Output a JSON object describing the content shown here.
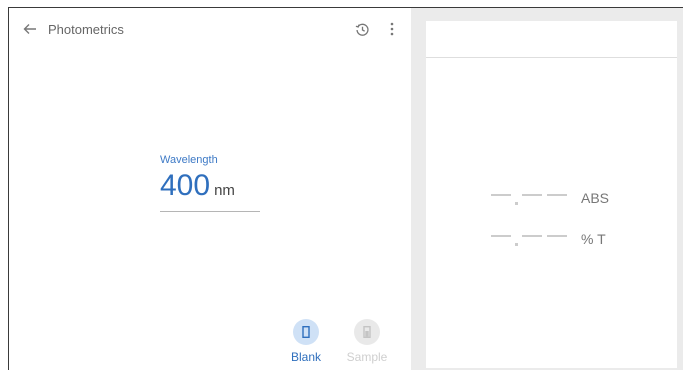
{
  "header": {
    "title": "Photometrics",
    "back_icon": "arrow-left-icon",
    "history_icon": "history-icon",
    "more_icon": "more-vertical-icon"
  },
  "wavelength": {
    "label": "Wavelength",
    "value": "400",
    "unit": "nm"
  },
  "modes": [
    {
      "label": "Blank",
      "icon": "cuvette-icon",
      "active": true,
      "color": "#2f6fbd"
    },
    {
      "label": "Sample",
      "icon": "cuvette-icon",
      "active": false,
      "color": "#cfcfcf"
    }
  ],
  "results": {
    "abs_unit": "ABS",
    "t_unit": "% T"
  },
  "colors": {
    "accent": "#2f6fbd",
    "active_bg": "#cfe1f6",
    "panel_bg": "#ebebeb"
  }
}
